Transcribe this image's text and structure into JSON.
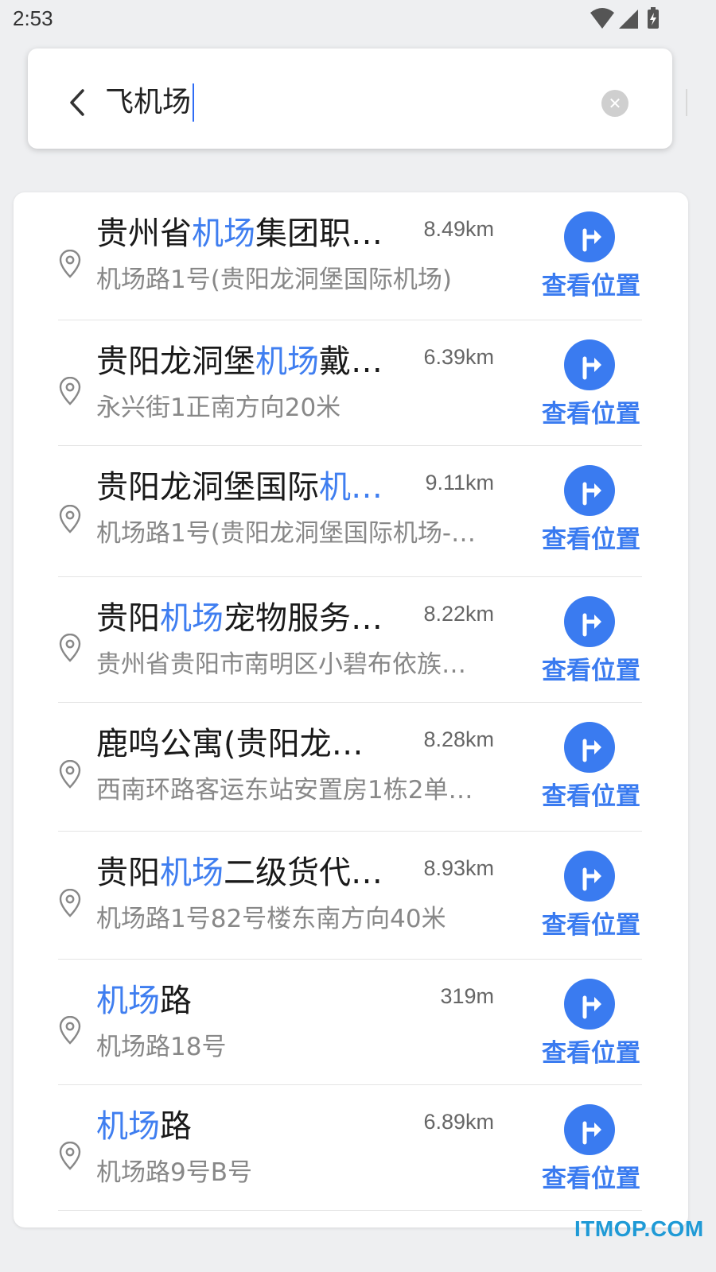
{
  "status_bar": {
    "time": "2:53"
  },
  "search": {
    "query": "飞机场"
  },
  "results": [
    {
      "title_parts": [
        [
          "贵州省",
          false
        ],
        [
          "机场",
          true
        ],
        [
          "集团职…",
          false
        ]
      ],
      "distance": "8.49km",
      "address": "机场路1号(贵阳龙洞堡国际机场)",
      "action": "查看位置"
    },
    {
      "title_parts": [
        [
          "贵阳龙洞堡",
          false
        ],
        [
          "机场",
          true
        ],
        [
          "戴…",
          false
        ]
      ],
      "distance": "6.39km",
      "address": "永兴街1正南方向20米",
      "action": "查看位置"
    },
    {
      "title_parts": [
        [
          "贵阳龙洞堡国际",
          false
        ],
        [
          "机…",
          true
        ]
      ],
      "distance": "9.11km",
      "address": "机场路1号(贵阳龙洞堡国际机场-…",
      "action": "查看位置"
    },
    {
      "title_parts": [
        [
          "贵阳",
          false
        ],
        [
          "机场",
          true
        ],
        [
          "宠物服务…",
          false
        ]
      ],
      "distance": "8.22km",
      "address": "贵州省贵阳市南明区小碧布依族…",
      "action": "查看位置"
    },
    {
      "title_parts": [
        [
          "鹿鸣公寓(贵阳龙…",
          false
        ]
      ],
      "distance": "8.28km",
      "address": "西南环路客运东站安置房1栋2单…",
      "action": "查看位置"
    },
    {
      "title_parts": [
        [
          "贵阳",
          false
        ],
        [
          "机场",
          true
        ],
        [
          "二级货代…",
          false
        ]
      ],
      "distance": "8.93km",
      "address": "机场路1号82号楼东南方向40米",
      "action": "查看位置"
    },
    {
      "title_parts": [
        [
          "机场",
          true
        ],
        [
          "路",
          false
        ]
      ],
      "distance": "319m",
      "address": "机场路18号",
      "action": "查看位置"
    },
    {
      "title_parts": [
        [
          "机场",
          true
        ],
        [
          "路",
          false
        ]
      ],
      "distance": "6.89km",
      "address": "机场路9号B号",
      "action": "查看位置"
    }
  ],
  "watermark": "ITMOP.COM",
  "colors": {
    "accent": "#3a7bf0",
    "highlight": "#3f7ef0",
    "background": "#eeeff1"
  }
}
